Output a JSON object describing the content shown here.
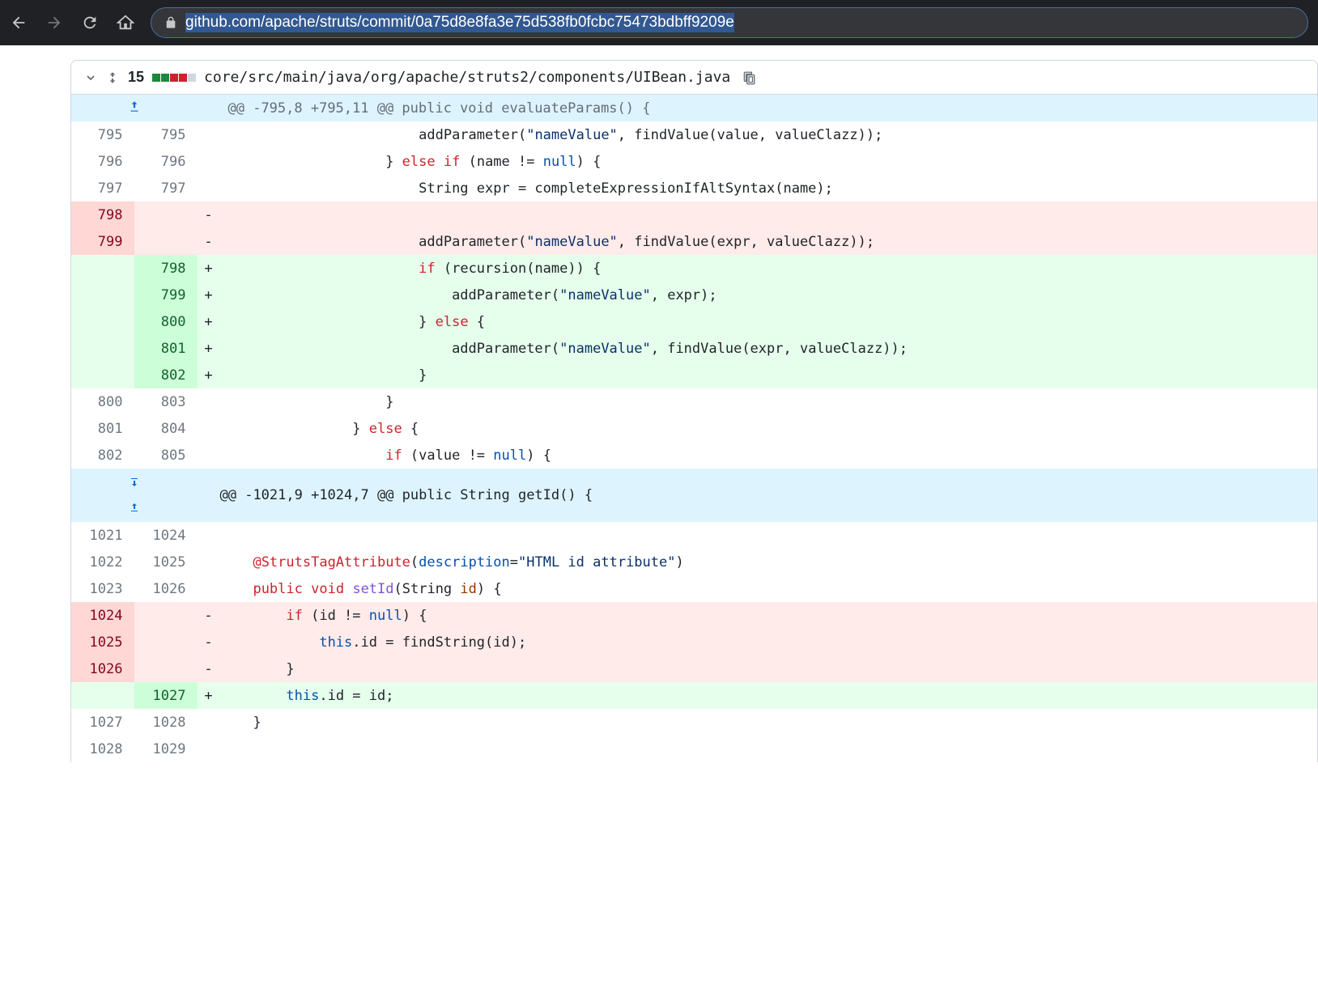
{
  "browser": {
    "url": "github.com/apache/struts/commit/0a75d8e8fa3e75d538fb0fcbc75473bdbff9209e"
  },
  "file": {
    "change_count": "15",
    "path": "core/src/main/java/org/apache/struts2/components/UIBean.java"
  },
  "hunks": [
    {
      "header": "@@ -795,8 +795,11 @@ public void evaluateParams() {"
    },
    {
      "header": "@@ -1021,9 +1024,7 @@ public String getId() {"
    }
  ],
  "lines": {
    "l795a": "795",
    "l795b": "795",
    "l796a": "796",
    "l796b": "796",
    "l797a": "797",
    "l797b": "797",
    "l798a": "798",
    "l799a": "799",
    "l798b": "798",
    "l799b": "799",
    "l800b": "800",
    "l801b": "801",
    "l802b": "802",
    "l800a": "800",
    "l803b": "803",
    "l801a": "801",
    "l804b": "804",
    "l802a": "802",
    "l805b": "805",
    "l1021a": "1021",
    "l1024b": "1024",
    "l1022a": "1022",
    "l1025b": "1025",
    "l1023a": "1023",
    "l1026b": "1026",
    "l1024a": "1024",
    "l1025a": "1025",
    "l1026a": "1026",
    "l1027b": "1027",
    "l1027a": "1027",
    "l1028b": "1028",
    "l1028a": "1028",
    "l1029b": "1029"
  },
  "code": {
    "c795": "                        addParameter(\"nameValue\", findValue(value, valueClazz));",
    "c796": "                    } else if (name != null) {",
    "c797": "                        String expr = completeExpressionIfAltSyntax(name);",
    "c798d": "",
    "c799d": "                        addParameter(\"nameValue\", findValue(expr, valueClazz));",
    "c798a": "                        if (recursion(name)) {",
    "c799a": "                            addParameter(\"nameValue\", expr);",
    "c800a": "                        } else {",
    "c801a": "                            addParameter(\"nameValue\", findValue(expr, valueClazz));",
    "c802a": "                        }",
    "c800": "                    }",
    "c801": "                } else {",
    "c802": "                    if (value != null) {",
    "c1021": "",
    "c1022": "    @StrutsTagAttribute(description=\"HTML id attribute\")",
    "c1023": "    public void setId(String id) {",
    "c1024d": "        if (id != null) {",
    "c1025d": "            this.id = findString(id);",
    "c1026d": "        }",
    "c1027a": "        this.id = id;",
    "c1027": "    }",
    "c1028": ""
  }
}
